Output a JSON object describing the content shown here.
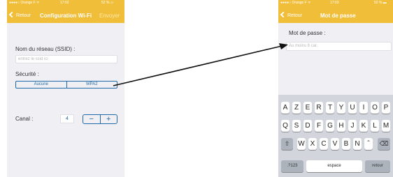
{
  "left_screen": {
    "status": {
      "carrier": "●●●●○ Orange F ᯤ",
      "time": "17:02",
      "battery": "52 % ▭"
    },
    "nav": {
      "back_label": "Retour",
      "title": "Configuration Wi-Fi",
      "action_label": "Envoyer"
    },
    "ssid": {
      "label": "Nom du réseau (SSID) :",
      "placeholder": "entrez le ssid ici"
    },
    "security": {
      "label": "Sécurité :",
      "options": [
        "Aucune",
        "WPA2"
      ],
      "selected": "WPA2"
    },
    "channel": {
      "label": "Canal :",
      "value": "4",
      "minus": "−",
      "plus": "+"
    }
  },
  "right_screen": {
    "status": {
      "carrier": "●●●●○ Orange F ᯤ",
      "time": "17:03",
      "battery": "52 % ▬"
    },
    "nav": {
      "back_label": "Retour",
      "title": "Mot de passe"
    },
    "password": {
      "label": "Mot de passe :",
      "placeholder": "Au moins 8 car."
    },
    "keyboard": {
      "row1": [
        "A",
        "Z",
        "E",
        "R",
        "T",
        "Y",
        "U",
        "I",
        "O",
        "P"
      ],
      "row2": [
        "Q",
        "S",
        "D",
        "F",
        "G",
        "H",
        "J",
        "K",
        "L",
        "M"
      ],
      "row3": [
        "W",
        "X",
        "C",
        "V",
        "B",
        "N",
        "ˆ"
      ],
      "shift": "⇧",
      "delete": "⌫",
      "numbers": ".?123",
      "space": "espace",
      "return": "retour"
    }
  },
  "colors": {
    "nav_bar": "#f1be3a",
    "accent_blue": "#1f6aa6",
    "screen_bg": "#efeff4",
    "keyboard_bg": "#d2d5db"
  }
}
